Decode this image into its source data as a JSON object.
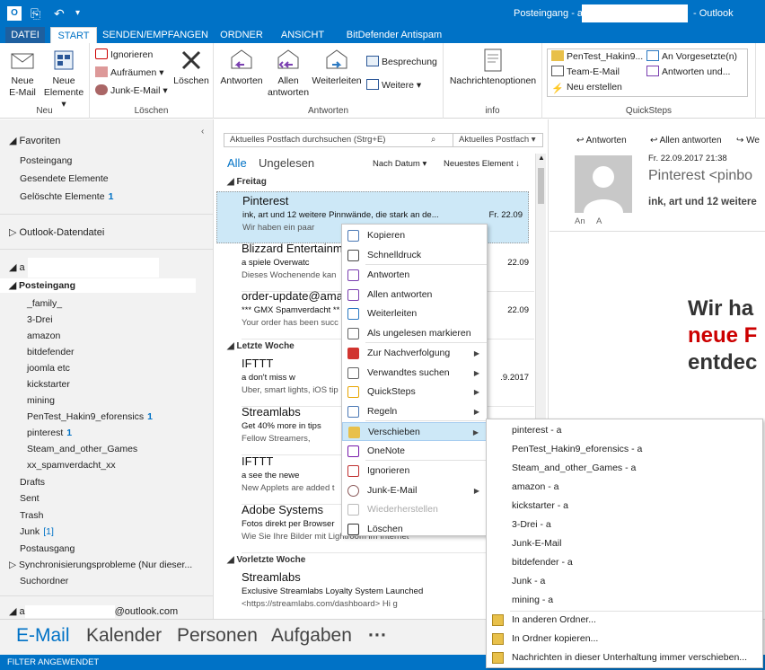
{
  "window": {
    "title_prefix": "Posteingang - a",
    "title_suffix": "- Outlook"
  },
  "tabs": [
    "DATEI",
    "START",
    "SENDEN/EMPFANGEN",
    "ORDNER",
    "ANSICHT",
    "BitDefender Antispam"
  ],
  "ribbon": {
    "neu": {
      "label": "Neu",
      "new_email_1": "Neue",
      "new_email_2": "E-Mail",
      "new_items_1": "Neue",
      "new_items_2": "Elemente"
    },
    "loeschen": {
      "label": "Löschen",
      "ignore": "Ignorieren",
      "cleanup": "Aufräumen",
      "junk": "Junk-E-Mail",
      "delete": "Löschen"
    },
    "antworten": {
      "label": "Antworten",
      "reply": "Antworten",
      "reply_all_1": "Allen",
      "reply_all_2": "antworten",
      "forward": "Weiterleiten",
      "meeting": "Besprechung",
      "more": "Weitere"
    },
    "info": {
      "label": "info",
      "msg_options": "Nachrichtenoptionen"
    },
    "quicksteps": {
      "label": "QuickSteps",
      "items": [
        "PenTest_Hakin9...",
        "An Vorgesetzte(n)",
        "Team-E-Mail",
        "Antworten und...",
        "Neu erstellen"
      ]
    }
  },
  "nav": {
    "favorites": "Favoriten",
    "fav_items": [
      {
        "label": "Posteingang",
        "count": ""
      },
      {
        "label": "Gesendete Elemente",
        "count": ""
      },
      {
        "label": "Gelöschte Elemente",
        "count": "1"
      }
    ],
    "datafile": "Outlook-Datendatei",
    "account_prefix": "a",
    "inbox": "Posteingang",
    "folders": [
      {
        "label": "_family_",
        "count": ""
      },
      {
        "label": "3-Drei",
        "count": ""
      },
      {
        "label": "amazon",
        "count": ""
      },
      {
        "label": "bitdefender",
        "count": ""
      },
      {
        "label": "joomla etc",
        "count": ""
      },
      {
        "label": "kickstarter",
        "count": ""
      },
      {
        "label": "mining",
        "count": ""
      },
      {
        "label": "PenTest_Hakin9_eforensics",
        "count": "1"
      },
      {
        "label": "pinterest",
        "count": "1"
      },
      {
        "label": "Steam_and_other_Games",
        "count": ""
      },
      {
        "label": "xx_spamverdacht_xx",
        "count": ""
      }
    ],
    "root_folders": [
      {
        "label": "Drafts",
        "count": ""
      },
      {
        "label": "Sent",
        "count": ""
      },
      {
        "label": "Trash",
        "count": ""
      },
      {
        "label": "Junk",
        "count": "[1]"
      },
      {
        "label": "Postausgang",
        "count": ""
      }
    ],
    "sync": "Synchronisierungsprobleme (Nur dieser...",
    "search_folder": "Suchordner",
    "outlook_account_prefix": "a",
    "outlook_account_suffix": "@outlook.com"
  },
  "list": {
    "search_placeholder": "Aktuelles Postfach durchsuchen (Strg+E)",
    "scope": "Aktuelles Postfach",
    "filter_all": "Alle",
    "filter_unread": "Ungelesen",
    "sort_by": "Nach Datum",
    "sort_order": "Neuestes Element",
    "groups": [
      "Freitag",
      "Letzte Woche",
      "Vorletzte Woche"
    ],
    "messages": [
      {
        "from": "Pinterest",
        "subject": "ink, art und 12 weitere Pinnwände, die stark an de...",
        "preview": "Wir haben ein paar",
        "date": "Fr. 22.09"
      },
      {
        "from": "Blizzard Entertainm",
        "subject": "a          spiele Overwatc",
        "preview": "Dieses Wochenende kan",
        "date": "22.09"
      },
      {
        "from": "order-update@ama",
        "subject": "*** GMX Spamverdacht **",
        "preview": "Your order has been succ",
        "date": "22.09"
      },
      {
        "from": "IFTTT",
        "subject": "a          don't miss w",
        "preview": "Uber, smart lights, iOS tip",
        "date": ".9.2017"
      },
      {
        "from": "Streamlabs",
        "subject": "Get 40% more in tips",
        "preview": "Fellow Streamers,",
        "date": ""
      },
      {
        "from": "IFTTT",
        "subject": "a          see the newe",
        "preview": "New Applets are added t",
        "date": ""
      },
      {
        "from": "Adobe Systems",
        "subject": "Fotos direkt per Browser",
        "preview": "Wie Sie Ihre Bilder mit Lightroom im Internet",
        "date": ""
      },
      {
        "from": "Streamlabs",
        "subject": "Exclusive Streamlabs Loyalty System Launched",
        "preview": "<https://streamlabs.com/dashboard>   Hi g",
        "date": "08.09"
      }
    ]
  },
  "reading": {
    "reply": "Antworten",
    "reply_all": "Allen antworten",
    "forward": "We",
    "date": "Fr. 22.09.2017 21:38",
    "sender": "Pinterest <pinbo",
    "subject": "ink, art und 12 weitere",
    "to_label": "An",
    "to_value": "A",
    "big_line1": "Wir ha",
    "big_line2": "neue F",
    "big_line3": "entdec",
    "red_color": "#cc0000"
  },
  "context_menu": [
    {
      "label": "Kopieren",
      "icon": "copy-icon",
      "submenu": false,
      "disabled": false
    },
    {
      "label": "Schnelldruck",
      "icon": "print-icon",
      "submenu": false,
      "disabled": false
    },
    {
      "label": "Antworten",
      "icon": "reply-icon",
      "submenu": false,
      "disabled": false
    },
    {
      "label": "Allen antworten",
      "icon": "reply-all-icon",
      "submenu": false,
      "disabled": false
    },
    {
      "label": "Weiterleiten",
      "icon": "forward-icon",
      "submenu": false,
      "disabled": false
    },
    {
      "label": "Als ungelesen markieren",
      "icon": "mark-unread-icon",
      "submenu": false,
      "disabled": false
    },
    {
      "label": "Zur Nachverfolgung",
      "icon": "flag-icon",
      "submenu": true,
      "disabled": false
    },
    {
      "label": "Verwandtes suchen",
      "icon": "find-related-icon",
      "submenu": true,
      "disabled": false
    },
    {
      "label": "QuickSteps",
      "icon": "lightning-icon",
      "submenu": true,
      "disabled": false
    },
    {
      "label": "Regeln",
      "icon": "rules-icon",
      "submenu": true,
      "disabled": false
    },
    {
      "label": "Verschieben",
      "icon": "move-folder-icon",
      "submenu": true,
      "disabled": false
    },
    {
      "label": "OneNote",
      "icon": "onenote-icon",
      "submenu": false,
      "disabled": false
    },
    {
      "label": "Ignorieren",
      "icon": "ignore-icon",
      "submenu": false,
      "disabled": false
    },
    {
      "label": "Junk-E-Mail",
      "icon": "junk-icon",
      "submenu": true,
      "disabled": false
    },
    {
      "label": "Wiederherstellen",
      "icon": "restore-icon",
      "submenu": false,
      "disabled": true
    },
    {
      "label": "Löschen",
      "icon": "delete-x-icon",
      "submenu": false,
      "disabled": false
    }
  ],
  "move_submenu": {
    "folders": [
      "pinterest - a",
      "PenTest_Hakin9_eforensics - a",
      "Steam_and_other_Games - a",
      "amazon - a",
      "kickstarter - a",
      "3-Drei - a",
      "Junk-E-Mail",
      "bitdefender - a",
      "Junk - a",
      "mining - a"
    ],
    "actions": [
      "In anderen Ordner...",
      "In Ordner kopieren...",
      "Nachrichten in dieser Unterhaltung immer verschieben..."
    ]
  },
  "bottom_nav": [
    "E-Mail",
    "Kalender",
    "Personen",
    "Aufgaben",
    "···"
  ],
  "status": "FILTER ANGEWENDET",
  "colors": {
    "accent": "#0072c6",
    "selection": "#cde8f7",
    "unread_count": "#0072c6"
  }
}
